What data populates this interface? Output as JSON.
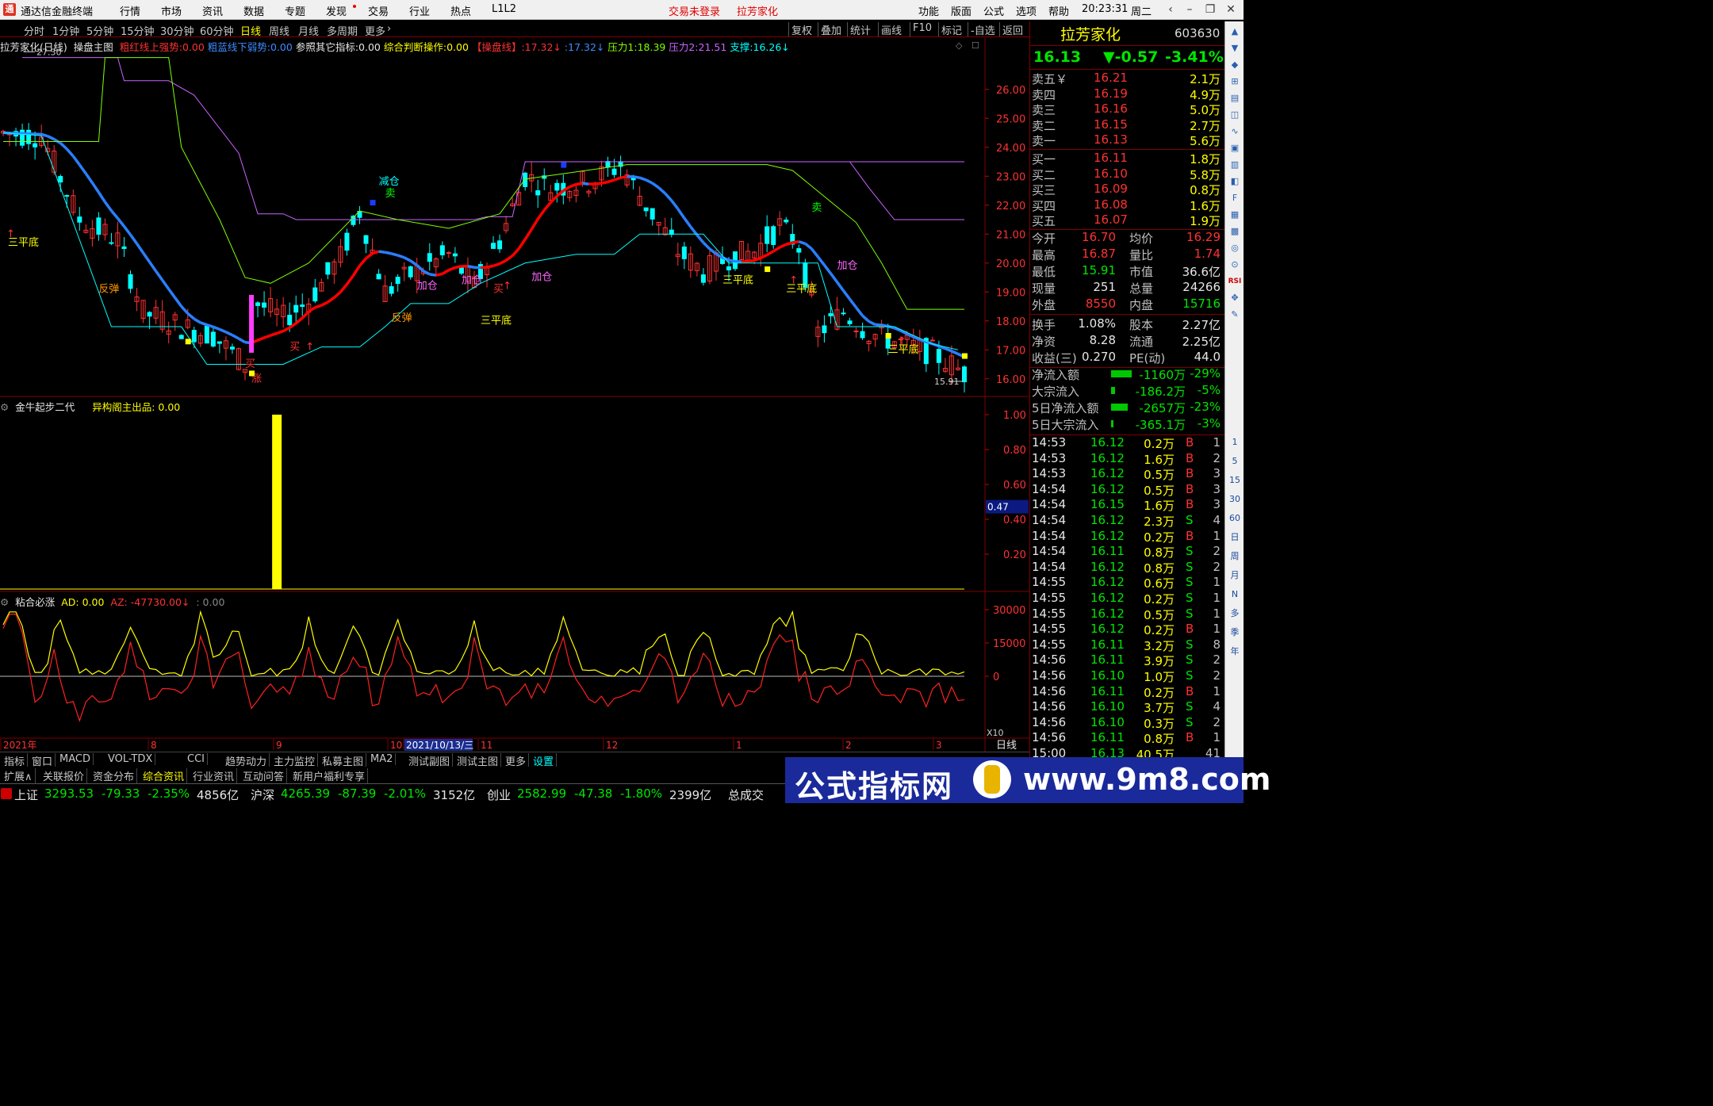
{
  "titlebar": {
    "app_title": "通达信金融终端",
    "menus": [
      "行情",
      "市场",
      "资讯",
      "数据",
      "专题",
      "发现",
      "交易",
      "行业",
      "热点",
      "L1L2"
    ],
    "login_status": "交易未登录",
    "current_stock": "拉芳家化",
    "right_menus": [
      "功能",
      "版面",
      "公式",
      "选项",
      "帮助"
    ],
    "time": "20:23:31",
    "weekday": "周二"
  },
  "toolbar": {
    "periods": [
      "分时",
      "1分钟",
      "5分钟",
      "15分钟",
      "30分钟",
      "60分钟",
      "日线",
      "周线",
      "月线",
      "多周期",
      "更多"
    ],
    "active_period": "日线",
    "right_buttons": [
      "复权",
      "叠加",
      "统计",
      "画线",
      "F10",
      "标记",
      "-自选",
      "返回"
    ]
  },
  "main_header": {
    "title": "拉芳家化(日线)",
    "formula": "操盘主图",
    "items": [
      {
        "label": "粗红线上强势:",
        "value": "0.00",
        "color": "#ff3232"
      },
      {
        "label": "粗蓝线下弱势:",
        "value": "0.00",
        "color": "#3c8cff"
      },
      {
        "label": "参照其它指标:",
        "value": "0.00",
        "color": "#e6e6e6"
      },
      {
        "label": "综合判断操作:",
        "value": "0.00",
        "color": "#ffff00"
      },
      {
        "label": "【操盘线】:",
        "value": "17.32↓",
        "color": "#ff3232"
      },
      {
        "label": ":",
        "value": "17.32↓",
        "color": "#3c8cff"
      },
      {
        "label": "压力1:",
        "value": "18.39",
        "color": "#7fff00"
      },
      {
        "label": "压力2:",
        "value": "21.51",
        "color": "#c864ff"
      },
      {
        "label": "支撑:",
        "value": "16.26↓",
        "color": "#00ffff"
      }
    ]
  },
  "main_chart": {
    "price_ticks": [
      "26.00",
      "25.00",
      "24.00",
      "23.00",
      "22.00",
      "21.00",
      "20.00",
      "19.00",
      "18.00",
      "17.00",
      "16.00"
    ],
    "high_label": "27.30",
    "low_label": "15.91",
    "signals": [
      "三平底",
      "反弹",
      "买",
      "减仓",
      "卖",
      "加仓",
      "加仓",
      "三平底",
      "加仓",
      "买",
      "反弹",
      "三平底",
      "卖",
      "三平底",
      "加仓",
      "三平底",
      "买",
      "涨"
    ]
  },
  "sub1": {
    "title": "金牛起步二代",
    "label": "异构阁主出品:",
    "value": "0.00",
    "ticks": [
      "1.00",
      "0.80",
      "0.60",
      "0.40",
      "0.20"
    ],
    "current": "0.47"
  },
  "sub2": {
    "title": "粘合必涨",
    "ad_label": "AD:",
    "ad_value": "0.00",
    "az_label": "AZ:",
    "az_value": "-47730.00↓",
    "extra": ": 0.00",
    "ticks": [
      "30000",
      "15000",
      "0"
    ],
    "scale": "X10"
  },
  "date_axis": {
    "labels": [
      "2021年",
      "8",
      "9",
      "10",
      "2021/10/13/三",
      "11",
      "12",
      "1",
      "2",
      "3"
    ],
    "period": "日线"
  },
  "quote": {
    "name": "拉芳家化",
    "code": "603630",
    "price": "16.13",
    "change": "▼-0.57",
    "change_pct": "-3.41%",
    "sells": [
      {
        "label": "卖五￥",
        "price": "16.21",
        "vol": "2.1万"
      },
      {
        "label": "卖四",
        "price": "16.19",
        "vol": "4.9万"
      },
      {
        "label": "卖三",
        "price": "16.16",
        "vol": "5.0万"
      },
      {
        "label": "卖二",
        "price": "16.15",
        "vol": "2.7万"
      },
      {
        "label": "卖一",
        "price": "16.13",
        "vol": "5.6万"
      }
    ],
    "buys": [
      {
        "label": "买一",
        "price": "16.11",
        "vol": "1.8万"
      },
      {
        "label": "买二",
        "price": "16.10",
        "vol": "5.8万"
      },
      {
        "label": "买三",
        "price": "16.09",
        "vol": "0.8万"
      },
      {
        "label": "买四",
        "price": "16.08",
        "vol": "1.6万"
      },
      {
        "label": "买五",
        "price": "16.07",
        "vol": "1.9万"
      }
    ],
    "stats": [
      {
        "l1": "今开",
        "v1": "16.70",
        "c1": "#ff3232",
        "l2": "均价",
        "v2": "16.29",
        "c2": "#ff3232"
      },
      {
        "l1": "最高",
        "v1": "16.87",
        "c1": "#ff3232",
        "l2": "量比",
        "v2": "1.74",
        "c2": "#ff3232"
      },
      {
        "l1": "最低",
        "v1": "15.91",
        "c1": "#00e600",
        "l2": "市值",
        "v2": "36.6亿",
        "c2": "#e6e6e6"
      },
      {
        "l1": "现量",
        "v1": "251",
        "c1": "#e6e6e6",
        "l2": "总量",
        "v2": "24266",
        "c2": "#e6e6e6"
      },
      {
        "l1": "外盘",
        "v1": "8550",
        "c1": "#ff3232",
        "l2": "内盘",
        "v2": "15716",
        "c2": "#00e600"
      }
    ],
    "stats2": [
      {
        "l1": "换手",
        "v1": "1.08%",
        "l2": "股本",
        "v2": "2.27亿"
      },
      {
        "l1": "净资",
        "v1": "8.28",
        "l2": "流通",
        "v2": "2.25亿"
      },
      {
        "l1": "收益(三)",
        "v1": "0.270",
        "l2": "PE(动)",
        "v2": "44.0"
      }
    ],
    "flows": [
      {
        "label": "净流入额",
        "value": "-1160万",
        "pct": "-29%",
        "bar": 0.29
      },
      {
        "label": "大宗流入",
        "value": "-186.2万",
        "pct": "-5%",
        "bar": 0.05
      },
      {
        "label": "5日净流入额",
        "value": "-2657万",
        "pct": "-23%",
        "bar": 0.23
      },
      {
        "label": "5日大宗流入",
        "value": "-365.1万",
        "pct": "-3%",
        "bar": 0.03
      }
    ],
    "ticks": [
      {
        "t": "14:53",
        "p": "16.12",
        "v": "0.2万",
        "s": "B",
        "n": "1"
      },
      {
        "t": "14:53",
        "p": "16.12",
        "v": "1.6万",
        "s": "B",
        "n": "2"
      },
      {
        "t": "14:53",
        "p": "16.12",
        "v": "0.5万",
        "s": "B",
        "n": "3"
      },
      {
        "t": "14:54",
        "p": "16.12",
        "v": "0.5万",
        "s": "B",
        "n": "3"
      },
      {
        "t": "14:54",
        "p": "16.15",
        "v": "1.6万",
        "s": "B",
        "n": "3"
      },
      {
        "t": "14:54",
        "p": "16.12",
        "v": "2.3万",
        "s": "S",
        "n": "4"
      },
      {
        "t": "14:54",
        "p": "16.12",
        "v": "0.2万",
        "s": "B",
        "n": "1"
      },
      {
        "t": "14:54",
        "p": "16.11",
        "v": "0.8万",
        "s": "S",
        "n": "2"
      },
      {
        "t": "14:54",
        "p": "16.12",
        "v": "0.8万",
        "s": "S",
        "n": "2"
      },
      {
        "t": "14:55",
        "p": "16.12",
        "v": "0.6万",
        "s": "S",
        "n": "1"
      },
      {
        "t": "14:55",
        "p": "16.12",
        "v": "0.2万",
        "s": "S",
        "n": "1"
      },
      {
        "t": "14:55",
        "p": "16.12",
        "v": "0.5万",
        "s": "S",
        "n": "1"
      },
      {
        "t": "14:55",
        "p": "16.12",
        "v": "0.2万",
        "s": "B",
        "n": "1"
      },
      {
        "t": "14:55",
        "p": "16.11",
        "v": "3.2万",
        "s": "S",
        "n": "8"
      },
      {
        "t": "14:56",
        "p": "16.11",
        "v": "3.9万",
        "s": "S",
        "n": "2"
      },
      {
        "t": "14:56",
        "p": "16.10",
        "v": "1.0万",
        "s": "S",
        "n": "2"
      },
      {
        "t": "14:56",
        "p": "16.11",
        "v": "0.2万",
        "s": "B",
        "n": "1"
      },
      {
        "t": "14:56",
        "p": "16.10",
        "v": "3.7万",
        "s": "S",
        "n": "4"
      },
      {
        "t": "14:56",
        "p": "16.10",
        "v": "0.3万",
        "s": "S",
        "n": "2"
      },
      {
        "t": "14:56",
        "p": "16.11",
        "v": "0.8万",
        "s": "B",
        "n": "1"
      },
      {
        "t": "15:00",
        "p": "16.13",
        "v": "40.5万",
        "s": "",
        "n": "41"
      }
    ]
  },
  "side_icons": [
    "1",
    "5",
    "15",
    "30",
    "60",
    "日",
    "周",
    "月",
    "N",
    "多",
    "季",
    "年"
  ],
  "tabs": [
    "指标",
    "窗口",
    "MACD",
    "VOL-TDX",
    "CCI",
    "趋势动力",
    "主力监控",
    "私募主图",
    "MA2",
    "测试副图",
    "测试主图",
    "更多",
    "设置"
  ],
  "selected_tab": "设置",
  "bar2": [
    "扩展∧",
    "关联报价",
    "资金分布",
    "综合资讯",
    "行业资讯",
    "互动问答",
    "新用户福利专享"
  ],
  "status": {
    "items": [
      {
        "name": "上证",
        "price": "3293.53",
        "chg": "-79.33",
        "pct": "-2.35%",
        "amt": "4856亿"
      },
      {
        "name": "沪深",
        "price": "4265.39",
        "chg": "-87.39",
        "pct": "-2.01%",
        "amt": "3152亿"
      },
      {
        "name": "创业",
        "price": "2582.99",
        "chg": "-47.38",
        "pct": "-1.80%",
        "amt": "2399亿"
      }
    ],
    "total_label": "总成交"
  },
  "banner": {
    "text": "公式指标网",
    "url": "www.9m8.com"
  },
  "colors": {
    "up": "#ff3232",
    "down": "#00ffff",
    "pressure1": "#7fff00",
    "pressure2": "#c864ff",
    "support": "#00ffff",
    "ma_up": "#ff0000",
    "ma_down": "#2a7fff",
    "frame": "#800000"
  }
}
